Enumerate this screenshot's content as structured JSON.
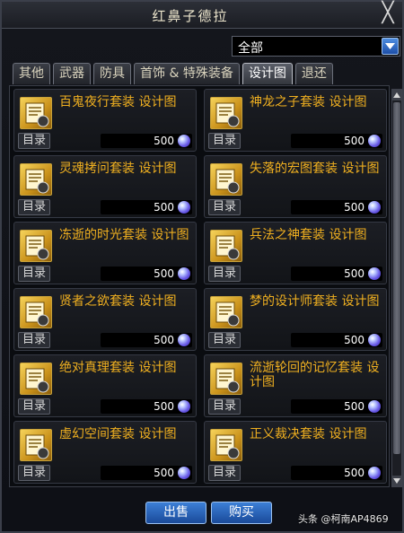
{
  "window": {
    "title": "红鼻子德拉",
    "close_glyph": "╳"
  },
  "filter": {
    "selected": "全部"
  },
  "tabs": [
    {
      "label": "其他",
      "active": false
    },
    {
      "label": "武器",
      "active": false
    },
    {
      "label": "防具",
      "active": false
    },
    {
      "label": "首饰 & 特殊装备",
      "active": false
    },
    {
      "label": "设计图",
      "active": true
    },
    {
      "label": "退还",
      "active": false
    }
  ],
  "catalog_label": "目录",
  "currency_icon": "orb-icon",
  "items": [
    {
      "name": "百鬼夜行套装  设计图",
      "price": "500"
    },
    {
      "name": "神龙之子套装  设计图",
      "price": "500"
    },
    {
      "name": "灵魂拷问套装  设计图",
      "price": "500"
    },
    {
      "name": "失落的宏图套装  设计图",
      "price": "500"
    },
    {
      "name": "冻逝的时光套装  设计图",
      "price": "500"
    },
    {
      "name": "兵法之神套装  设计图",
      "price": "500"
    },
    {
      "name": "贤者之欲套装  设计图",
      "price": "500"
    },
    {
      "name": "梦的设计师套装  设计图",
      "price": "500"
    },
    {
      "name": "绝对真理套装  设计图",
      "price": "500"
    },
    {
      "name": "流逝轮回的记忆套装  设计图",
      "price": "500"
    },
    {
      "name": "虚幻空间套装  设计图",
      "price": "500"
    },
    {
      "name": "正义裁决套装  设计图",
      "price": "500"
    }
  ],
  "buttons": {
    "sell": "出售",
    "buy": "购买"
  },
  "watermark": "头条 @柯南AP4869",
  "colors": {
    "item_name": "#f0b020",
    "accent_blue": "#2d6cc8"
  }
}
